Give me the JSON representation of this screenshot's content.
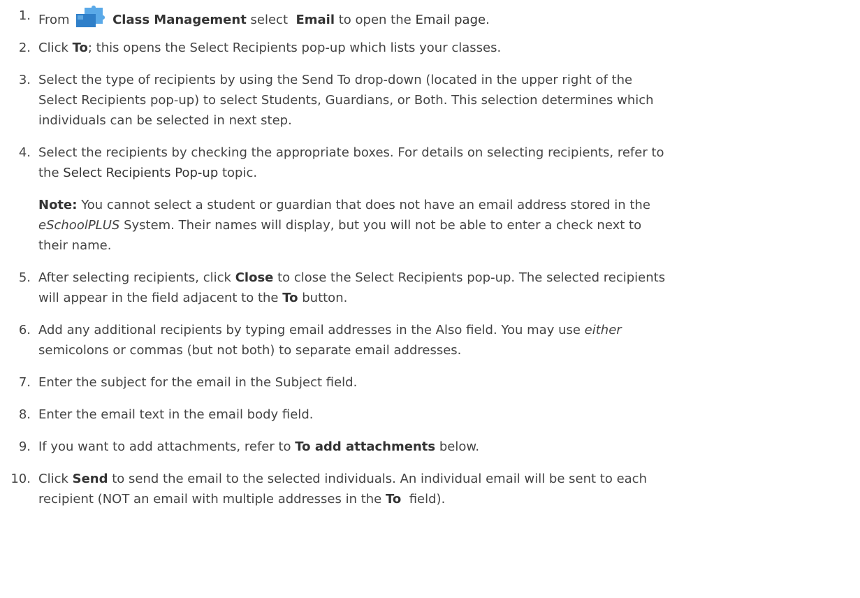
{
  "steps": [
    {
      "num": "1.",
      "from": "From",
      "class_management": "Class Management",
      "select": "select",
      "email": "Email",
      "to_open_the": "to open the",
      "email_page": "Email page",
      "end": "."
    },
    {
      "num": "2.",
      "click": "Click",
      "to": "To",
      "rest": "; this opens the Select Recipients pop-up which lists your classes."
    },
    {
      "num": "3.",
      "line1": "Select the type of recipients by using the Send To drop-down (located in the upper right of the",
      "line2": "Select Recipients pop-up) to select Students, Guardians, or Both. This selection determines which",
      "line3": "individuals can be selected in next step."
    },
    {
      "num": "4.",
      "line1": "Select the recipients by checking the appropriate boxes. For details on selecting recipients, refer to",
      "the": "the",
      "link": "Select Recipients Pop-up",
      "topic": "topic."
    },
    {
      "note_label": "Note:",
      "note_line1": "You cannot select a student or guardian that does not have an email address stored in the",
      "product": "eSchoolPLUS",
      "note_line2_rest": "System. Their names will display, but you will not be able to enter a check next to",
      "note_line3": "their name."
    },
    {
      "num": "5.",
      "after": "After selecting recipients, click",
      "close": "Close",
      "line1_rest": "to close the Select Recipients pop-up. The selected recipients",
      "line2_pre": "will appear in the field adjacent to the",
      "to": "To",
      "line2_post": "button."
    },
    {
      "num": "6.",
      "line1_pre": "Add any additional recipients by typing email addresses in the Also field. You may use",
      "either": "either",
      "line2": "semicolons or commas (but not both) to separate email addresses."
    },
    {
      "num": "7.",
      "text": "Enter the subject for the email in the Subject field."
    },
    {
      "num": "8.",
      "text": "Enter the email text in the email body field."
    },
    {
      "num": "9.",
      "pre": "If you want to add attachments, refer to",
      "bold": "To add attachments",
      "post": "below."
    },
    {
      "num": "10.",
      "click": "Click",
      "send": "Send",
      "line1_rest": "to send the email to the selected individuals. An individual email will be sent to each",
      "line2_pre": "recipient (NOT an email with multiple addresses in the",
      "to": "To",
      "line2_post": "field)."
    }
  ],
  "icon": {
    "name": "puzzle-piece-icon",
    "color": "#3a8fd6"
  }
}
